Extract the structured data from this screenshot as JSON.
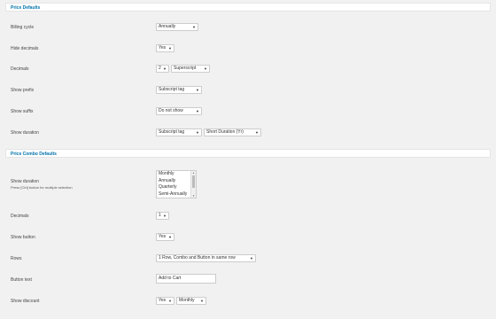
{
  "sections": {
    "price_defaults": "Price Defaults",
    "price_combo_defaults": "Price Combo Defaults"
  },
  "fields": {
    "billing_cycle": {
      "label": "Billing cycle",
      "value": "Annually"
    },
    "hide_decimals": {
      "label": "Hide decimals",
      "value": "Yes"
    },
    "decimals": {
      "label": "Decimals",
      "value": "2",
      "position": "Superscript"
    },
    "show_prefix": {
      "label": "Show prefix",
      "value": "Subscript tag"
    },
    "show_suffix": {
      "label": "Show suffix",
      "value": "Do not show"
    },
    "show_duration": {
      "label": "Show duration",
      "value": "Subscript tag",
      "format": "Short Duration (Yr)"
    },
    "combo_show_duration": {
      "label": "Show duration",
      "help": "Press [Ctrl] button for multiple selection",
      "options": [
        "Monthly",
        "Annually",
        "Quarterly",
        "Semi-Annually"
      ]
    },
    "combo_decimals": {
      "label": "Decimals",
      "value": "1"
    },
    "show_button": {
      "label": "Show button",
      "value": "Yes"
    },
    "rows": {
      "label": "Rows",
      "value": "1 Row, Combo and Button in same row"
    },
    "button_text": {
      "label": "Button text",
      "value": "Add to Cart"
    },
    "show_discount": {
      "label": "Show discount",
      "value": "Yes",
      "period": "Monthly"
    }
  },
  "icons": {
    "dropdown": "chevron-down-icon"
  }
}
